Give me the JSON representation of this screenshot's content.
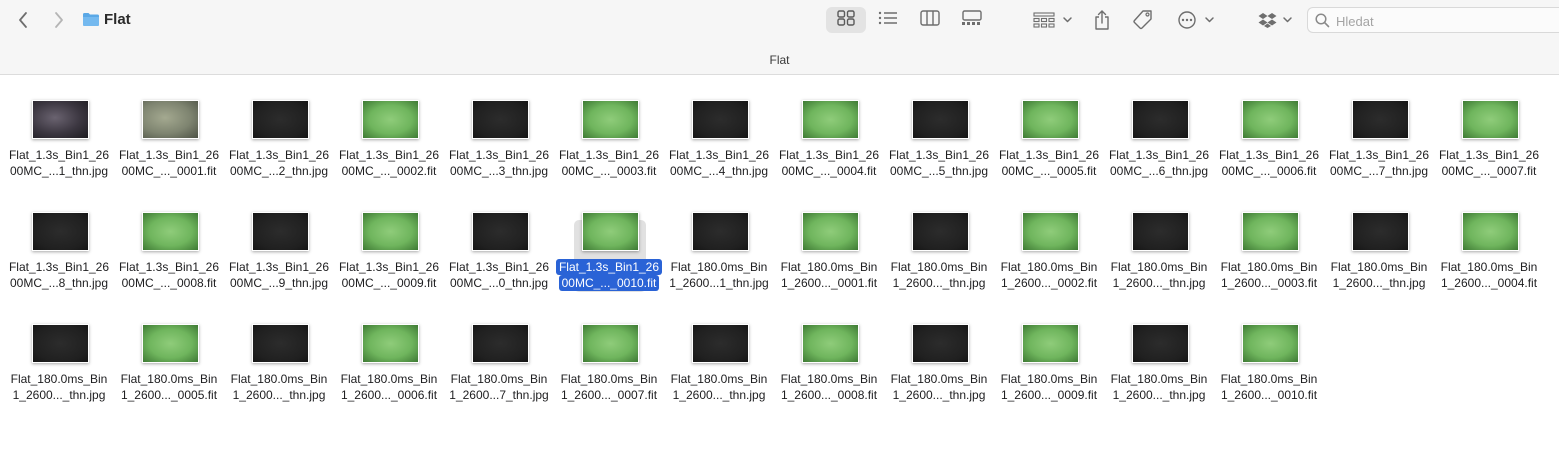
{
  "window": {
    "title": "Flat",
    "path_title": "Flat",
    "search_placeholder": "Hledat"
  },
  "toolbar": {
    "icons": [
      "back-icon",
      "forward-icon",
      "folder-icon",
      "icon-view-icon",
      "list-view-icon",
      "column-view-icon",
      "gallery-view-icon",
      "group-icon",
      "share-icon",
      "tag-icon",
      "more-icon",
      "dropbox-icon",
      "search-icon"
    ],
    "active_view": "icon-view"
  },
  "files": [
    {
      "line1": "Flat_1.3s_Bin1_26",
      "line2": "00MC_...1_thn.jpg",
      "thumb": "darkpurple"
    },
    {
      "line1": "Flat_1.3s_Bin1_26",
      "line2": "00MC_..._0001.fit",
      "thumb": "graygreen"
    },
    {
      "line1": "Flat_1.3s_Bin1_26",
      "line2": "00MC_...2_thn.jpg",
      "thumb": "dark"
    },
    {
      "line1": "Flat_1.3s_Bin1_26",
      "line2": "00MC_..._0002.fit",
      "thumb": "green"
    },
    {
      "line1": "Flat_1.3s_Bin1_26",
      "line2": "00MC_...3_thn.jpg",
      "thumb": "dark"
    },
    {
      "line1": "Flat_1.3s_Bin1_26",
      "line2": "00MC_..._0003.fit",
      "thumb": "green"
    },
    {
      "line1": "Flat_1.3s_Bin1_26",
      "line2": "00MC_...4_thn.jpg",
      "thumb": "dark"
    },
    {
      "line1": "Flat_1.3s_Bin1_26",
      "line2": "00MC_..._0004.fit",
      "thumb": "green"
    },
    {
      "line1": "Flat_1.3s_Bin1_26",
      "line2": "00MC_...5_thn.jpg",
      "thumb": "dark"
    },
    {
      "line1": "Flat_1.3s_Bin1_26",
      "line2": "00MC_..._0005.fit",
      "thumb": "green"
    },
    {
      "line1": "Flat_1.3s_Bin1_26",
      "line2": "00MC_...6_thn.jpg",
      "thumb": "dark"
    },
    {
      "line1": "Flat_1.3s_Bin1_26",
      "line2": "00MC_..._0006.fit",
      "thumb": "green"
    },
    {
      "line1": "Flat_1.3s_Bin1_26",
      "line2": "00MC_...7_thn.jpg",
      "thumb": "dark"
    },
    {
      "line1": "Flat_1.3s_Bin1_26",
      "line2": "00MC_..._0007.fit",
      "thumb": "green"
    },
    {
      "line1": "Flat_1.3s_Bin1_26",
      "line2": "00MC_...8_thn.jpg",
      "thumb": "dark"
    },
    {
      "line1": "Flat_1.3s_Bin1_26",
      "line2": "00MC_..._0008.fit",
      "thumb": "green"
    },
    {
      "line1": "Flat_1.3s_Bin1_26",
      "line2": "00MC_...9_thn.jpg",
      "thumb": "dark"
    },
    {
      "line1": "Flat_1.3s_Bin1_26",
      "line2": "00MC_..._0009.fit",
      "thumb": "green"
    },
    {
      "line1": "Flat_1.3s_Bin1_26",
      "line2": "00MC_...0_thn.jpg",
      "thumb": "dark"
    },
    {
      "line1": "Flat_1.3s_Bin1_26",
      "line2": "00MC_..._0010.fit",
      "thumb": "green",
      "selected": true
    },
    {
      "line1": "Flat_180.0ms_Bin",
      "line2": "1_2600...1_thn.jpg",
      "thumb": "dark"
    },
    {
      "line1": "Flat_180.0ms_Bin",
      "line2": "1_2600..._0001.fit",
      "thumb": "green"
    },
    {
      "line1": "Flat_180.0ms_Bin",
      "line2": "1_2600..._thn.jpg",
      "thumb": "dark"
    },
    {
      "line1": "Flat_180.0ms_Bin",
      "line2": "1_2600..._0002.fit",
      "thumb": "green"
    },
    {
      "line1": "Flat_180.0ms_Bin",
      "line2": "1_2600..._thn.jpg",
      "thumb": "dark"
    },
    {
      "line1": "Flat_180.0ms_Bin",
      "line2": "1_2600..._0003.fit",
      "thumb": "green"
    },
    {
      "line1": "Flat_180.0ms_Bin",
      "line2": "1_2600..._thn.jpg",
      "thumb": "dark"
    },
    {
      "line1": "Flat_180.0ms_Bin",
      "line2": "1_2600..._0004.fit",
      "thumb": "green"
    },
    {
      "line1": "Flat_180.0ms_Bin",
      "line2": "1_2600..._thn.jpg",
      "thumb": "dark"
    },
    {
      "line1": "Flat_180.0ms_Bin",
      "line2": "1_2600..._0005.fit",
      "thumb": "green"
    },
    {
      "line1": "Flat_180.0ms_Bin",
      "line2": "1_2600..._thn.jpg",
      "thumb": "dark"
    },
    {
      "line1": "Flat_180.0ms_Bin",
      "line2": "1_2600..._0006.fit",
      "thumb": "green"
    },
    {
      "line1": "Flat_180.0ms_Bin",
      "line2": "1_2600...7_thn.jpg",
      "thumb": "dark"
    },
    {
      "line1": "Flat_180.0ms_Bin",
      "line2": "1_2600..._0007.fit",
      "thumb": "green"
    },
    {
      "line1": "Flat_180.0ms_Bin",
      "line2": "1_2600..._thn.jpg",
      "thumb": "dark"
    },
    {
      "line1": "Flat_180.0ms_Bin",
      "line2": "1_2600..._0008.fit",
      "thumb": "green"
    },
    {
      "line1": "Flat_180.0ms_Bin",
      "line2": "1_2600..._thn.jpg",
      "thumb": "dark"
    },
    {
      "line1": "Flat_180.0ms_Bin",
      "line2": "1_2600..._0009.fit",
      "thumb": "green"
    },
    {
      "line1": "Flat_180.0ms_Bin",
      "line2": "1_2600..._thn.jpg",
      "thumb": "dark"
    },
    {
      "line1": "Flat_180.0ms_Bin",
      "line2": "1_2600..._0010.fit",
      "thumb": "green"
    }
  ],
  "colors": {
    "selection": "#2a63d6",
    "toolbar_bg": "#f6f6f6"
  }
}
